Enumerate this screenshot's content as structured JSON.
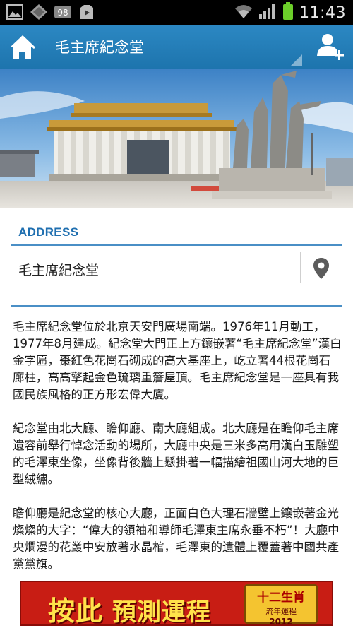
{
  "status_bar": {
    "time": "11:43",
    "notification_badge": "98",
    "icons": [
      "gallery-icon",
      "diamond-icon",
      "badge-icon",
      "play-store-icon",
      "wifi-icon",
      "signal-icon",
      "battery-icon"
    ]
  },
  "app_bar": {
    "title": "毛主席紀念堂",
    "icons": [
      "home-icon",
      "add-user-icon"
    ],
    "color": "#2580bb"
  },
  "address": {
    "label": "ADDRESS",
    "value": "毛主席紀念堂",
    "icon": "map-pin-icon"
  },
  "description": {
    "paragraphs": [
      "毛主席紀念堂位於北京天安門廣場南端。1976年11月動工，1977年8月建成。紀念堂大門正上方鑲嵌著“毛主席紀念堂”漢白金字匾，棗紅色花崗石砌成的高大基座上，屹立著44根花崗石廊柱，高高擎起金色琉璃重簷屋頂。毛主席紀念堂是一座具有我國民族風格的正方形宏偉大廈。",
      "紀念堂由北大廳、瞻仰廳、南大廳組成。北大廳是在瞻仰毛主席遺容前舉行悼念活動的場所，大廳中央是三米多高用漢白玉雕塑的毛澤東坐像，坐像背後牆上懸掛著一幅描繪祖國山河大地的巨型絨繡。",
      "瞻仰廳是紀念堂的核心大廳，正面白色大理石牆壁上鑲嵌著金光燦燦的大字：“偉大的領袖和導師毛澤東主席永垂不朽”！大廳中央爛漫的花叢中安放著水晶棺，毛澤東的遺體上覆蓋著中國共產黨黨旗。"
    ]
  },
  "ad_banner": {
    "main_text_1": "按此",
    "main_text_2": "預測運程",
    "badge_title": "十二生肖",
    "badge_sub": "流年運程",
    "badge_year": "2012"
  }
}
